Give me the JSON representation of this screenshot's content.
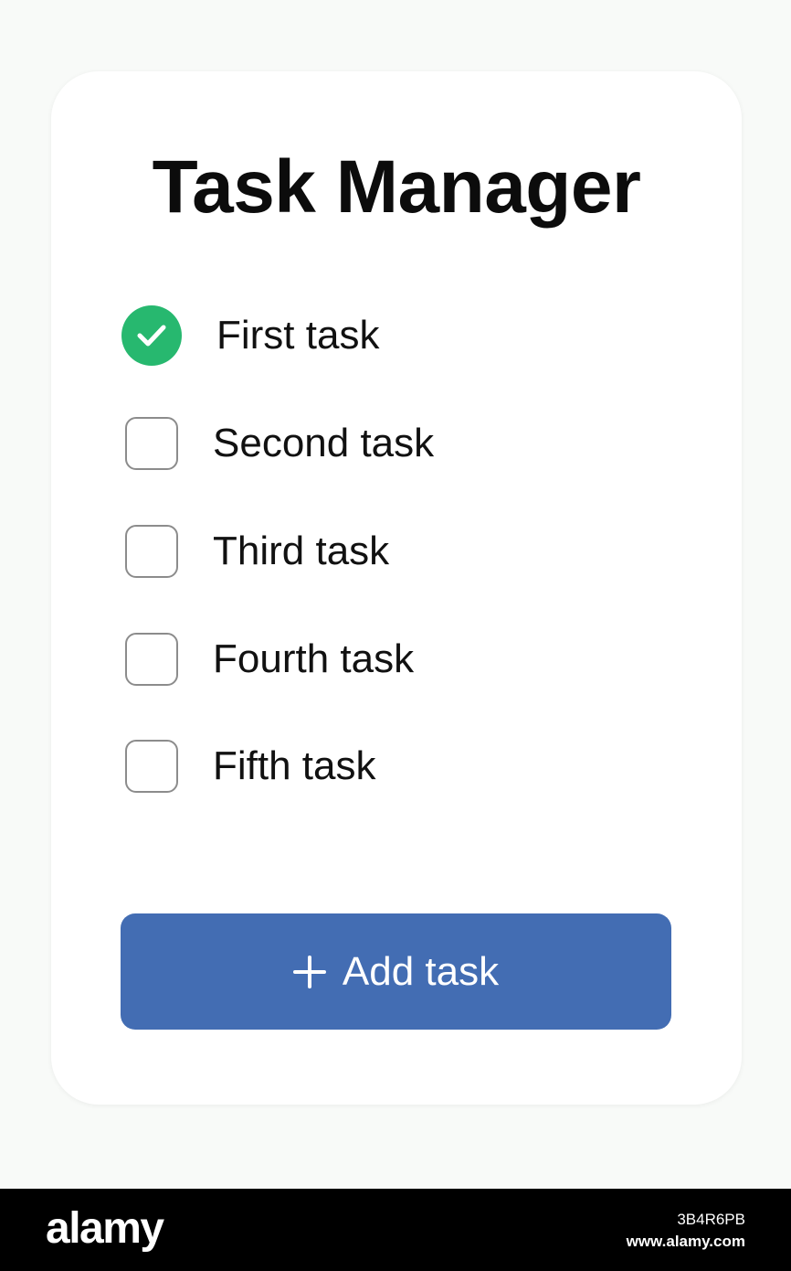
{
  "app": {
    "title": "Task Manager"
  },
  "colors": {
    "page_background": "#f8faf8",
    "card_background": "#ffffff",
    "check_green": "#27b86f",
    "button_blue": "#436db3",
    "checkbox_border": "#8c8c8c"
  },
  "tasks": [
    {
      "label": "First task",
      "checked": true,
      "icon": "check-icon"
    },
    {
      "label": "Second task",
      "checked": false
    },
    {
      "label": "Third task",
      "checked": false
    },
    {
      "label": "Fourth task",
      "checked": false
    },
    {
      "label": "Fifth task",
      "checked": false
    }
  ],
  "add_button": {
    "label": "Add task",
    "icon": "plus-icon"
  },
  "watermark": {
    "logo": "alamy",
    "image_id": "3B4R6PB",
    "url": "www.alamy.com"
  }
}
